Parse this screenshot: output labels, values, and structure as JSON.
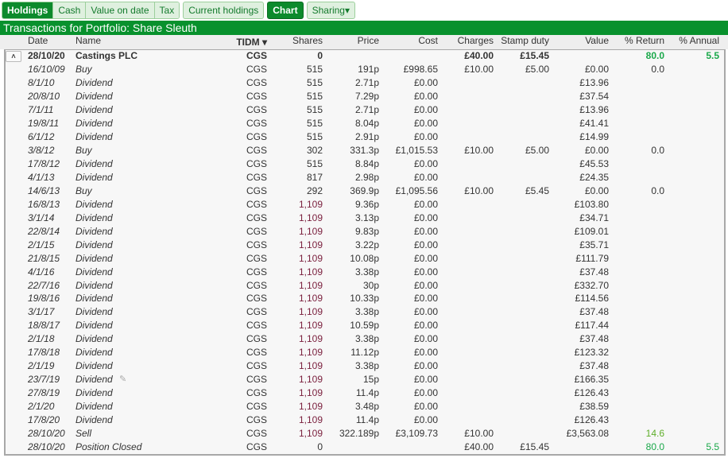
{
  "toolbar": {
    "group1": [
      {
        "label": "Holdings",
        "active": true
      },
      {
        "label": "Cash"
      },
      {
        "label": "Value on date"
      },
      {
        "label": "Tax"
      }
    ],
    "current_holdings": "Current holdings",
    "chart": "Chart",
    "sharing": "Sharing▾"
  },
  "title": "Transactions for Portfolio: Share Sleuth",
  "columns": {
    "date": "Date",
    "name": "Name",
    "tidm": "TIDM ▾",
    "shares": "Shares",
    "price": "Price",
    "cost": "Cost",
    "charges": "Charges",
    "stamp": "Stamp duty",
    "value": "Value",
    "ret": "% Return",
    "annual": "% Annual"
  },
  "summary": {
    "date": "28/10/20",
    "name": "Castings PLC",
    "tidm": "CGS",
    "shares": "0",
    "price": "",
    "cost": "",
    "charges": "£40.00",
    "stamp": "£15.45",
    "value": "",
    "ret": "80.0",
    "annual": "5.5",
    "collapse_icon": "˄"
  },
  "rows": [
    [
      "16/10/09",
      "Buy",
      "CGS",
      "515",
      "191p",
      "£998.65",
      "£10.00",
      "£5.00",
      "£0.00",
      "0.0",
      ""
    ],
    [
      "8/1/10",
      "Dividend",
      "CGS",
      "515",
      "2.71p",
      "£0.00",
      "",
      "",
      "£13.96",
      "",
      ""
    ],
    [
      "20/8/10",
      "Dividend",
      "CGS",
      "515",
      "7.29p",
      "£0.00",
      "",
      "",
      "£37.54",
      "",
      ""
    ],
    [
      "7/1/11",
      "Dividend",
      "CGS",
      "515",
      "2.71p",
      "£0.00",
      "",
      "",
      "£13.96",
      "",
      ""
    ],
    [
      "19/8/11",
      "Dividend",
      "CGS",
      "515",
      "8.04p",
      "£0.00",
      "",
      "",
      "£41.41",
      "",
      ""
    ],
    [
      "6/1/12",
      "Dividend",
      "CGS",
      "515",
      "2.91p",
      "£0.00",
      "",
      "",
      "£14.99",
      "",
      ""
    ],
    [
      "3/8/12",
      "Buy",
      "CGS",
      "302",
      "331.3p",
      "£1,015.53",
      "£10.00",
      "£5.00",
      "£0.00",
      "0.0",
      ""
    ],
    [
      "17/8/12",
      "Dividend",
      "CGS",
      "515",
      "8.84p",
      "£0.00",
      "",
      "",
      "£45.53",
      "",
      ""
    ],
    [
      "4/1/13",
      "Dividend",
      "CGS",
      "817",
      "2.98p",
      "£0.00",
      "",
      "",
      "£24.35",
      "",
      ""
    ],
    [
      "14/6/13",
      "Buy",
      "CGS",
      "292",
      "369.9p",
      "£1,095.56",
      "£10.00",
      "£5.45",
      "£0.00",
      "0.0",
      ""
    ],
    [
      "16/8/13",
      "Dividend",
      "CGS",
      "1,109",
      "9.36p",
      "£0.00",
      "",
      "",
      "£103.80",
      "",
      ""
    ],
    [
      "3/1/14",
      "Dividend",
      "CGS",
      "1,109",
      "3.13p",
      "£0.00",
      "",
      "",
      "£34.71",
      "",
      ""
    ],
    [
      "22/8/14",
      "Dividend",
      "CGS",
      "1,109",
      "9.83p",
      "£0.00",
      "",
      "",
      "£109.01",
      "",
      ""
    ],
    [
      "2/1/15",
      "Dividend",
      "CGS",
      "1,109",
      "3.22p",
      "£0.00",
      "",
      "",
      "£35.71",
      "",
      ""
    ],
    [
      "21/8/15",
      "Dividend",
      "CGS",
      "1,109",
      "10.08p",
      "£0.00",
      "",
      "",
      "£111.79",
      "",
      ""
    ],
    [
      "4/1/16",
      "Dividend",
      "CGS",
      "1,109",
      "3.38p",
      "£0.00",
      "",
      "",
      "£37.48",
      "",
      ""
    ],
    [
      "22/7/16",
      "Dividend",
      "CGS",
      "1,109",
      "30p",
      "£0.00",
      "",
      "",
      "£332.70",
      "",
      ""
    ],
    [
      "19/8/16",
      "Dividend",
      "CGS",
      "1,109",
      "10.33p",
      "£0.00",
      "",
      "",
      "£114.56",
      "",
      ""
    ],
    [
      "3/1/17",
      "Dividend",
      "CGS",
      "1,109",
      "3.38p",
      "£0.00",
      "",
      "",
      "£37.48",
      "",
      ""
    ],
    [
      "18/8/17",
      "Dividend",
      "CGS",
      "1,109",
      "10.59p",
      "£0.00",
      "",
      "",
      "£117.44",
      "",
      ""
    ],
    [
      "2/1/18",
      "Dividend",
      "CGS",
      "1,109",
      "3.38p",
      "£0.00",
      "",
      "",
      "£37.48",
      "",
      ""
    ],
    [
      "17/8/18",
      "Dividend",
      "CGS",
      "1,109",
      "11.12p",
      "£0.00",
      "",
      "",
      "£123.32",
      "",
      ""
    ],
    [
      "2/1/19",
      "Dividend",
      "CGS",
      "1,109",
      "3.38p",
      "£0.00",
      "",
      "",
      "£37.48",
      "",
      ""
    ],
    [
      "23/7/19",
      "Dividend",
      "CGS",
      "1,109",
      "15p",
      "£0.00",
      "",
      "",
      "£166.35",
      "",
      ""
    ],
    [
      "27/8/19",
      "Dividend",
      "CGS",
      "1,109",
      "11.4p",
      "£0.00",
      "",
      "",
      "£126.43",
      "",
      ""
    ],
    [
      "2/1/20",
      "Dividend",
      "CGS",
      "1,109",
      "3.48p",
      "£0.00",
      "",
      "",
      "£38.59",
      "",
      ""
    ],
    [
      "17/8/20",
      "Dividend",
      "CGS",
      "1,109",
      "11.4p",
      "£0.00",
      "",
      "",
      "£126.43",
      "",
      ""
    ],
    [
      "28/10/20",
      "Sell",
      "CGS",
      "1,109",
      "322.189p",
      "£3,109.73",
      "£10.00",
      "",
      "£3,563.08",
      "14.6",
      ""
    ],
    [
      "28/10/20",
      "Position Closed",
      "CGS",
      "0",
      "",
      "",
      "£40.00",
      "£15.45",
      "",
      "80.0",
      "5.5"
    ]
  ],
  "edit_icon_row": 23,
  "colors": {
    "brand_green": "#08912d",
    "shares_highlight": "#7a1f3d",
    "return_positive": "#1aa84a",
    "return_partial": "#5fae2a"
  }
}
